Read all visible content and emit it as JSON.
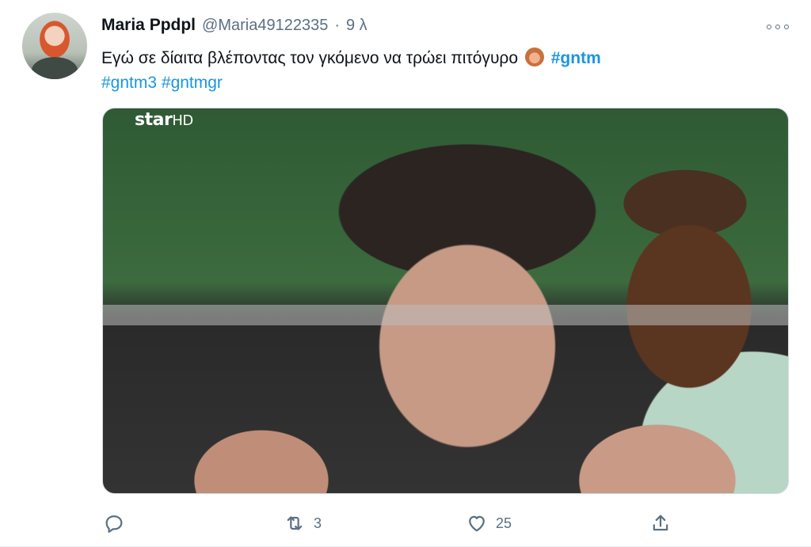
{
  "tweet": {
    "author_name": "Maria Ppdpl",
    "handle": "@Maria49122335",
    "separator": "·",
    "time": "9 λ",
    "text_main": "Εγώ σε δίαιτα βλέποντας τον γκόμενο να τρώει πιτόγυρο",
    "hashtags": [
      "#gntm",
      "#gntm3",
      "#gntmgr"
    ],
    "emoji_name": "see-no-evil-monkey-emoji"
  },
  "media": {
    "watermark_main": "star",
    "watermark_suffix": "HD",
    "description_icon": "video-thumbnail"
  },
  "actions": {
    "reply_count": "",
    "retweet_count": "3",
    "like_count": "25",
    "icons": [
      "reply-icon",
      "retweet-icon",
      "like-icon",
      "share-icon"
    ]
  },
  "colors": {
    "link": "#1b95e0",
    "muted": "#5b7083",
    "text": "#0f1419"
  }
}
